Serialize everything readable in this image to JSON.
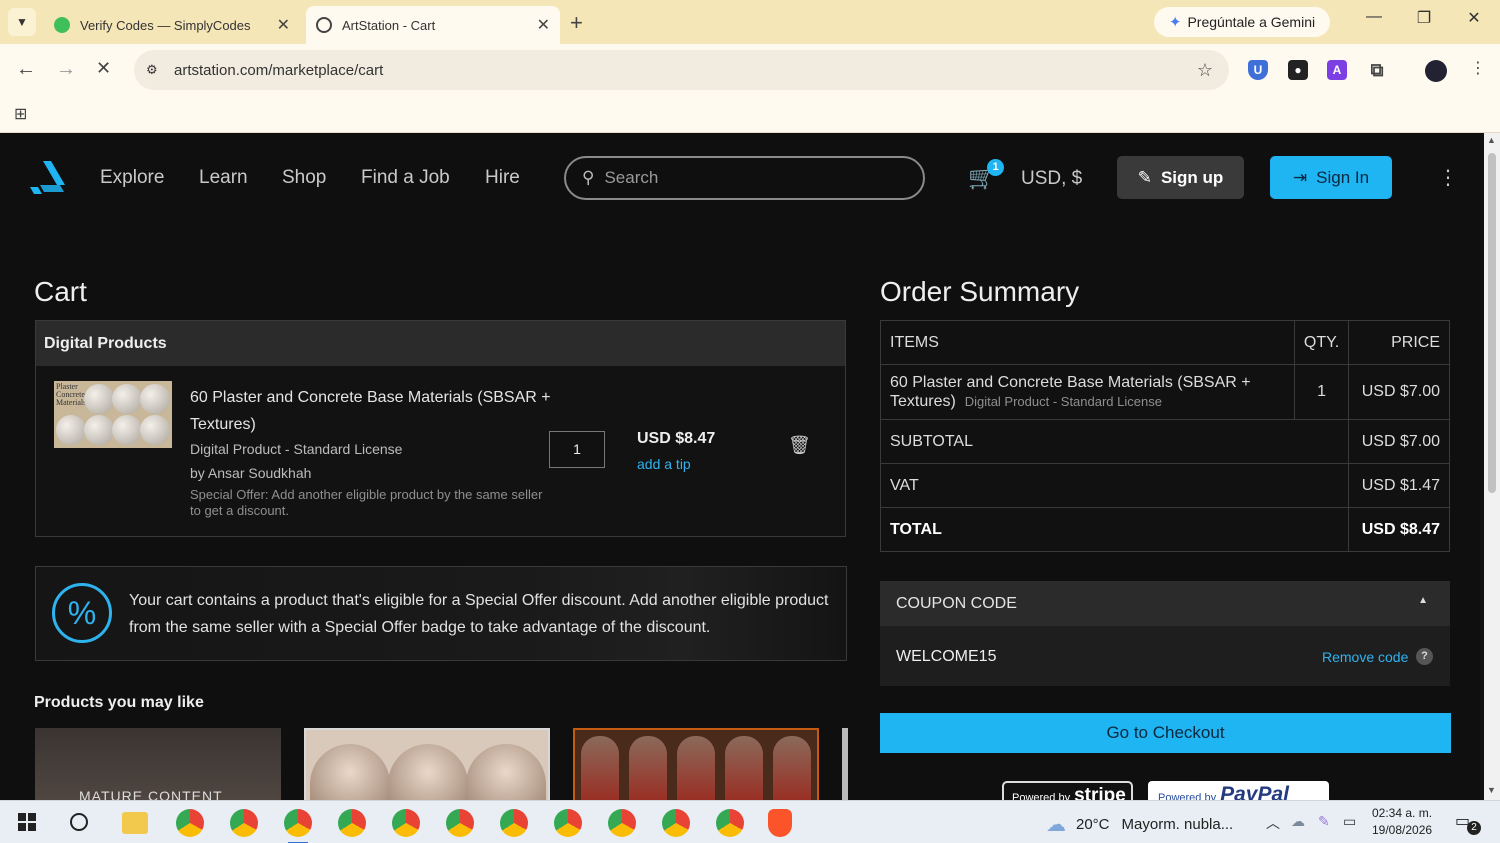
{
  "browser": {
    "tabs": [
      {
        "title": "Verify Codes — SimplyCodes",
        "favicon": "simplycodes-icon",
        "active": false
      },
      {
        "title": "ArtStation - Cart",
        "favicon": "artstation-icon",
        "active": true
      }
    ],
    "gemini_label": "Pregúntale a Gemini",
    "url": "artstation.com/marketplace/cart"
  },
  "header": {
    "nav": [
      "Explore",
      "Learn",
      "Shop",
      "Find a Job",
      "Hire"
    ],
    "search_placeholder": "Search",
    "cart_count": "1",
    "currency": "USD, $",
    "signup_label": "Sign up",
    "signin_label": "Sign In"
  },
  "cart": {
    "title": "Cart",
    "section_label": "Digital Products",
    "item": {
      "thumb_label": "Plaster Concrete Materials",
      "title": "60 Plaster and Concrete Base Materials (SBSAR + Textures)",
      "license": "Digital Product - Standard License",
      "author": "by Ansar Soudkhah",
      "offer_note": "Special Offer: Add another eligible product by the same seller to get a discount.",
      "quantity": "1",
      "price": "USD $8.47",
      "tip_label": "add a tip"
    },
    "offer_banner": "Your cart contains a product that's eligible for a Special Offer discount. Add another eligible product from the same seller with a Special Offer badge to take advantage of the discount.",
    "suggest_title": "Products you may like",
    "mature_label": "MATURE CONTENT"
  },
  "summary": {
    "title": "Order Summary",
    "columns": {
      "items": "ITEMS",
      "qty": "QTY.",
      "price": "PRICE"
    },
    "row": {
      "name": "60 Plaster and Concrete Base Materials (SBSAR + Textures)",
      "license": "Digital Product - Standard License",
      "qty": "1",
      "price": "USD $7.00"
    },
    "subtotal_label": "SUBTOTAL",
    "subtotal": "USD $7.00",
    "vat_label": "VAT",
    "vat": "USD $1.47",
    "total_label": "TOTAL",
    "total": "USD $8.47",
    "coupon_label": "COUPON CODE",
    "coupon_code": "WELCOME15",
    "remove_code_label": "Remove code",
    "checkout_label": "Go to Checkout",
    "stripe_prefix": "Powered by",
    "stripe_brand": "stripe",
    "paypal_prefix": "Powered by",
    "paypal_brand": "PayPal"
  },
  "taskbar": {
    "weather_temp": "20°C",
    "weather_desc": "Mayorm. nubla...",
    "time": "02:34 a. m.",
    "date": "19/08/2026",
    "notifications": "2"
  },
  "colors": {
    "accent": "#1fb4f2",
    "page_bg": "#0f0f0f",
    "tab_bar": "#f5e6b8"
  }
}
